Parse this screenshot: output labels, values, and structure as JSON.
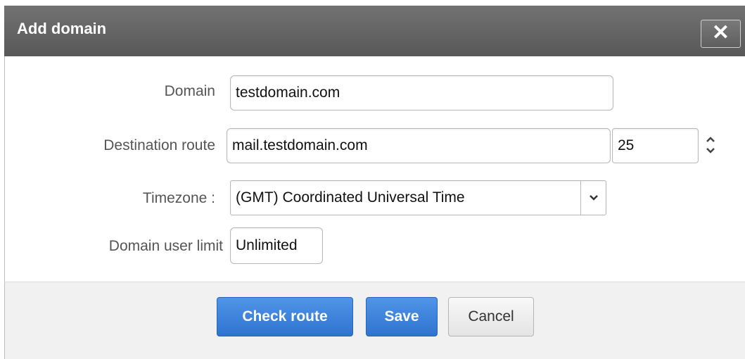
{
  "dialog": {
    "title": "Add domain",
    "close_label": "✕"
  },
  "form": {
    "domain_label": "Domain",
    "domain_value": "testdomain.com",
    "route_label": "Destination route",
    "route_value": "mail.testdomain.com",
    "port_value": "25",
    "timezone_label": "Timezone :",
    "timezone_value": "(GMT) Coordinated Universal Time",
    "user_limit_label": "Domain user limit",
    "user_limit_value": "Unlimited"
  },
  "footer": {
    "check_route_label": "Check route",
    "save_label": "Save",
    "cancel_label": "Cancel"
  },
  "icons": {
    "close": "close-icon",
    "spinner_up": "chevron-up-icon",
    "spinner_down": "chevron-down-icon",
    "select": "chevron-down-icon"
  },
  "colors": {
    "titlebar": "#5f5f5f",
    "primary_button": "#3a80dc",
    "footer_bg": "#f1f1f1"
  }
}
